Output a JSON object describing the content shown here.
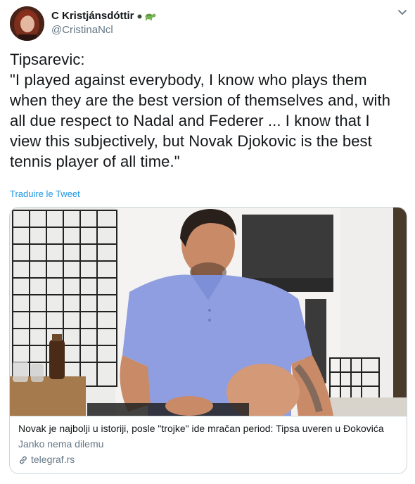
{
  "author": {
    "display_name": "C Kristjánsdóttir",
    "handle": "@CristinaNcl",
    "name_emoji": [
      "tennis-ball-icon",
      "turtle-icon"
    ]
  },
  "tweet": {
    "lines": [
      "Tipsarevic:",
      "\"I played against everybody, I know who plays them when they are the best version of themselves and, with all due respect to Nadal and Federer ... I know that I view this subjectively, but Novak Djokovic is the best tennis player of all time.\""
    ],
    "translate_label": "Traduire le Tweet"
  },
  "card": {
    "title": "Novak je najbolji u istoriji, posle \"trojke\" ide mračan period: Tipsa uveren u Đokovića",
    "description": "Janko nema dilemu",
    "domain": "telegraf.rs",
    "image_subject": "man-in-blue-polo-photo"
  },
  "colors": {
    "accent": "#1b95e0",
    "secondary_text": "#657786",
    "border": "#ccd6dd",
    "polo_blue": "#8e9ee0"
  }
}
